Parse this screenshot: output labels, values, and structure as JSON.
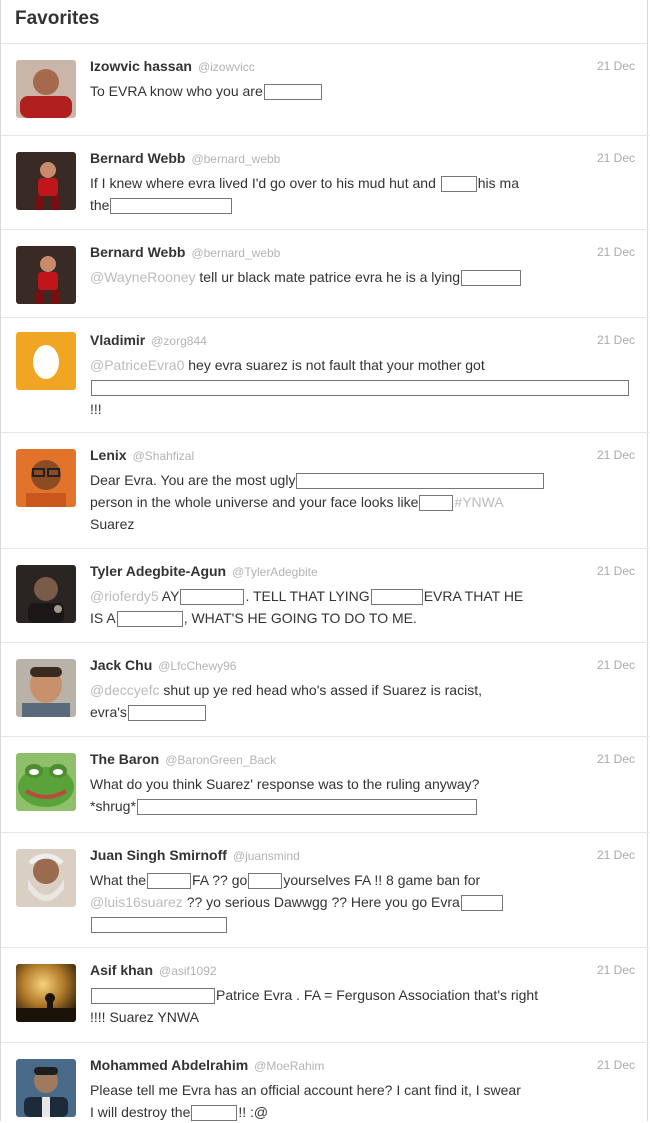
{
  "header": {
    "title": "Favorites"
  },
  "tweets": [
    {
      "name": "Izowvic hassan",
      "handle": "@izowvicc",
      "time": "21 Dec",
      "parts": [
        "To EVRA know who you are"
      ]
    },
    {
      "name": "Bernard Webb",
      "handle": "@bernard_webb",
      "time": "21 Dec",
      "parts": [
        "If I knew where evra lived I'd go over to his mud hut and ",
        "his ma",
        "the"
      ]
    },
    {
      "name": "Bernard Webb",
      "handle": "@bernard_webb",
      "time": "21 Dec",
      "parts": [
        "@WayneRooney",
        " tell ur black mate patrice evra he is a lying"
      ]
    },
    {
      "name": "Vladimir",
      "handle": "@zorg844",
      "time": "21 Dec",
      "parts": [
        "@PatriceEvra0",
        " hey evra suarez is not fault that your mother got",
        "!!!"
      ]
    },
    {
      "name": "Lenix",
      "handle": "@Shahfizal",
      "time": "21 Dec",
      "parts": [
        "Dear Evra. You are the most ugly",
        "person in the whole universe and your face looks like",
        "#YNWA",
        "Suarez"
      ]
    },
    {
      "name": "Tyler Adegbite-Agun",
      "handle": "@TylerAdegbite",
      "time": "21 Dec",
      "parts": [
        "@rioferdy5",
        " AY",
        ". TELL THAT LYING",
        "EVRA THAT HE",
        "IS A",
        ", WHAT'S HE GOING TO DO TO ME."
      ]
    },
    {
      "name": "Jack Chu",
      "handle": "@LfcChewy96",
      "time": "21 Dec",
      "parts": [
        "@deccyefc",
        " shut up ye red head who's assed if Suarez is racist,",
        "evra's"
      ]
    },
    {
      "name": "The Baron",
      "handle": "@BaronGreen_Back",
      "time": "21 Dec",
      "parts": [
        "What do you think Suarez' response was to the ruling anyway?",
        "*shrug*"
      ]
    },
    {
      "name": "Juan Singh Smirnoff",
      "handle": "@juansmind",
      "time": "21 Dec",
      "parts": [
        "What the",
        "FA ?? go",
        "yourselves FA !! 8 game ban for",
        "@luis16suarez",
        " ?? yo serious Dawwgg ?? Here you go Evra"
      ]
    },
    {
      "name": "Asif khan",
      "handle": "@asif1092",
      "time": "21 Dec",
      "parts": [
        "Patrice Evra . FA = Ferguson Association that's right",
        "!!!! Suarez YNWA"
      ]
    },
    {
      "name": "Mohammed Abdelrahim",
      "handle": "@MoeRahim",
      "time": "21 Dec",
      "parts": [
        "Please tell me Evra has an official account here? I cant find it, I swear",
        "I will destroy the",
        "!! :@"
      ]
    }
  ]
}
